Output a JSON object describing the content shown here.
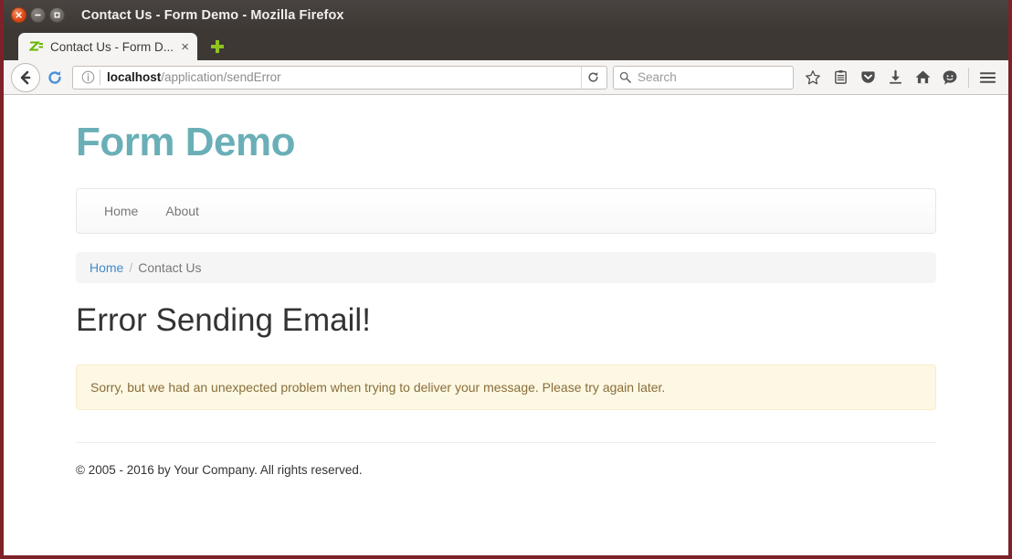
{
  "window": {
    "title": "Contact Us - Form Demo - Mozilla Firefox",
    "controls": {
      "close": "close-window",
      "minimize": "minimize-window",
      "maximize": "maximize-window"
    }
  },
  "tab": {
    "title": "Contact Us - Form D...",
    "favicon": "zend-framework-icon",
    "close_label": "×",
    "newtab_label": "+"
  },
  "toolbar": {
    "back_icon": "back-arrow-icon",
    "forward_icon": "reload-forward-icon",
    "identity_icon": "info-icon",
    "url": {
      "host": "localhost",
      "path": "/application/sendError",
      "full": "localhost/application/sendError"
    },
    "urlbar_reload_icon": "reload-icon",
    "search": {
      "placeholder": "Search",
      "icon": "search-icon",
      "value": ""
    },
    "icons": [
      {
        "name": "bookmark-star-icon",
        "label": "Bookmark this page"
      },
      {
        "name": "reading-list-icon",
        "label": "Reading list"
      },
      {
        "name": "pocket-icon",
        "label": "Save to Pocket"
      },
      {
        "name": "downloads-icon",
        "label": "Downloads"
      },
      {
        "name": "home-icon",
        "label": "Home"
      },
      {
        "name": "sync-account-icon",
        "label": "Account"
      },
      {
        "name": "hamburger-menu-icon",
        "label": "Open menu"
      }
    ]
  },
  "page": {
    "site_title": "Form Demo",
    "nav": {
      "items": [
        {
          "label": "Home"
        },
        {
          "label": "About"
        }
      ]
    },
    "breadcrumb": {
      "home": "Home",
      "separator": "/",
      "current": "Contact Us"
    },
    "heading": "Error Sending Email!",
    "alert": {
      "type": "warning",
      "message": "Sorry, but we had an unexpected problem when trying to deliver your message. Please try again later."
    },
    "footer": {
      "text": "© 2005 - 2016 by Your Company. All rights reserved."
    }
  },
  "colors": {
    "brand_teal": "#6aafb7",
    "link_blue": "#428bca",
    "alert_bg": "#fcf8e3",
    "alert_border": "#faebcc",
    "alert_text": "#8a6d3b",
    "window_border": "#7d2229",
    "heading_dark": "#333333"
  }
}
